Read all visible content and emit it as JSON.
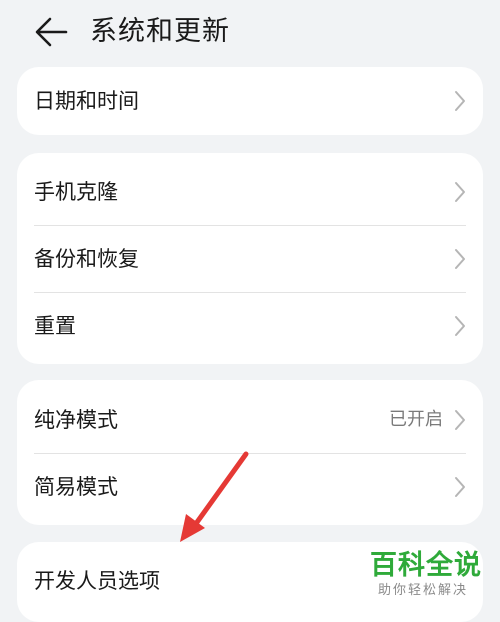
{
  "header": {
    "title": "系统和更新",
    "back_icon": "back-arrow-icon"
  },
  "groups": [
    {
      "items": [
        {
          "label": "日期和时间"
        }
      ]
    },
    {
      "items": [
        {
          "label": "手机克隆"
        },
        {
          "label": "备份和恢复"
        },
        {
          "label": "重置"
        }
      ]
    },
    {
      "items": [
        {
          "label": "纯净模式",
          "value": "已开启"
        },
        {
          "label": "简易模式"
        }
      ]
    },
    {
      "items": [
        {
          "label": "开发人员选项"
        }
      ]
    }
  ],
  "watermark": {
    "title": "百科全说",
    "subtitle": "助你轻松解决"
  },
  "colors": {
    "background": "#f1f3f5",
    "card": "#ffffff",
    "annotation_arrow": "#e53935",
    "watermark_green": "#2faa3a"
  }
}
